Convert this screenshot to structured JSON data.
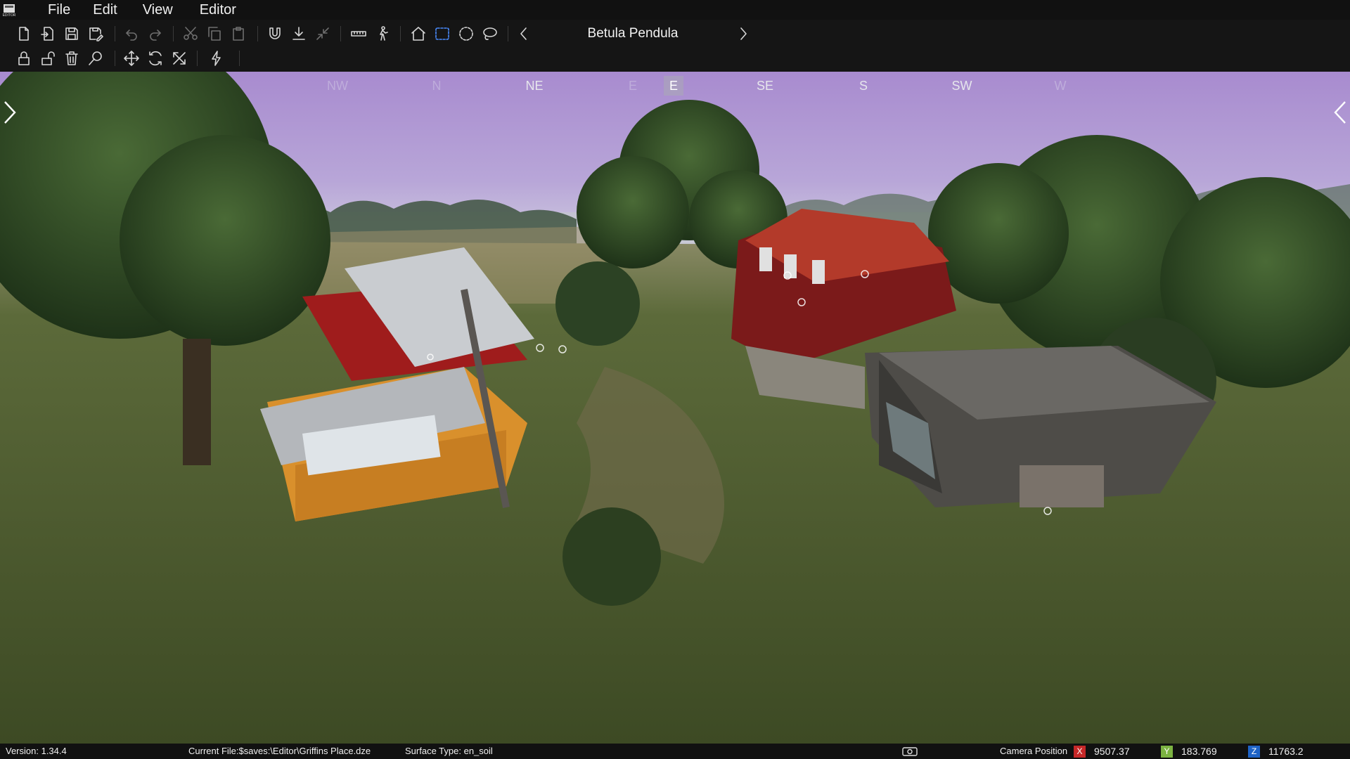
{
  "menubar": {
    "logo_text": "EDITOR",
    "items": [
      "File",
      "Edit",
      "View",
      "Editor"
    ]
  },
  "toolbar": {
    "row1_icons": [
      "new-file-icon",
      "open-file-icon",
      "save-icon",
      "save-as-icon",
      "undo-icon",
      "redo-icon",
      "cut-icon",
      "copy-icon",
      "paste-icon",
      "magnet-icon",
      "ground-snap-icon",
      "collapse-icon",
      "ruler-icon",
      "walk-icon",
      "home-icon",
      "box-select-icon",
      "circle-select-icon",
      "lasso-select-icon"
    ],
    "object_title": "Betula Pendula",
    "row2_icons": [
      "lock-icon",
      "unlock-icon",
      "delete-icon",
      "search-icon",
      "move-icon",
      "rotate-icon",
      "scale-icon",
      "lightning-icon"
    ]
  },
  "compass": {
    "labels": [
      {
        "text": "NW",
        "state": "faint"
      },
      {
        "text": "N",
        "state": "faint"
      },
      {
        "text": "NE",
        "state": "normal"
      },
      {
        "text": "E",
        "state": "faint"
      },
      {
        "text": "E",
        "state": "current"
      },
      {
        "text": "SE",
        "state": "normal"
      },
      {
        "text": "S",
        "state": "normal"
      },
      {
        "text": "SW",
        "state": "normal"
      },
      {
        "text": "W",
        "state": "faint"
      }
    ]
  },
  "status": {
    "version": "Version:  1.34.4",
    "current_file": "Current File:$saves:\\Editor\\Griffins Place.dze",
    "surface_type": "Surface Type: en_soil",
    "camera_label": "Camera Position",
    "camera": {
      "x_label": "X",
      "x_value": "9507.37",
      "x_color": "#c62828",
      "y_label": "Y",
      "y_value": "183.769",
      "y_color": "#7cb342",
      "z_label": "Z",
      "z_value": "11763.2",
      "z_color": "#1e63c6"
    }
  },
  "colors": {
    "sky_top": "#a98ad0",
    "sky_horizon": "#c9c4dc",
    "grass": "#4c5a2c",
    "selection_blue": "#4a8cff"
  }
}
